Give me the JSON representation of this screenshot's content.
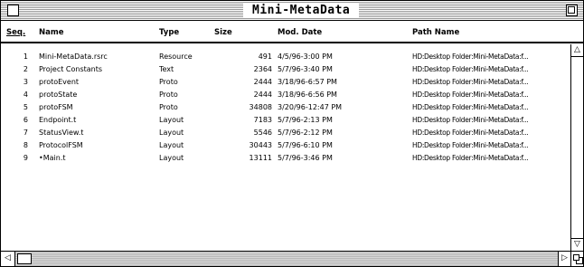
{
  "window": {
    "title": "Mini-MetaData"
  },
  "header": {
    "seq": "Seq.",
    "name": "Name",
    "type": "Type",
    "size": "Size",
    "date": "Mod. Date",
    "path": "Path Name"
  },
  "rows": [
    {
      "seq": "1",
      "name": "Mini-MetaData.rsrc",
      "type": "Resource",
      "size": "491",
      "date": "4/5/96-3:00 PM",
      "path": "HD:Desktop Folder:Mini-MetaData:f..."
    },
    {
      "seq": "2",
      "name": "Project Constants",
      "type": "Text",
      "size": "2364",
      "date": "5/7/96-3:40 PM",
      "path": "HD:Desktop Folder:Mini-MetaData:f..."
    },
    {
      "seq": "3",
      "name": "protoEvent",
      "type": "Proto",
      "size": "2444",
      "date": "3/18/96-6:57 PM",
      "path": "HD:Desktop Folder:Mini-MetaData:f..."
    },
    {
      "seq": "4",
      "name": "protoState",
      "type": "Proto",
      "size": "2444",
      "date": "3/18/96-6:56 PM",
      "path": "HD:Desktop Folder:Mini-MetaData:f..."
    },
    {
      "seq": "5",
      "name": "protoFSM",
      "type": "Proto",
      "size": "34808",
      "date": "3/20/96-12:47 PM",
      "path": "HD:Desktop Folder:Mini-MetaData:f..."
    },
    {
      "seq": "6",
      "name": "Endpoint.t",
      "type": "Layout",
      "size": "7183",
      "date": "5/7/96-2:13 PM",
      "path": "HD:Desktop Folder:Mini-MetaData:f..."
    },
    {
      "seq": "7",
      "name": "StatusView.t",
      "type": "Layout",
      "size": "5546",
      "date": "5/7/96-2:12 PM",
      "path": "HD:Desktop Folder:Mini-MetaData:f..."
    },
    {
      "seq": "8",
      "name": "ProtocolFSM",
      "type": "Layout",
      "size": "30443",
      "date": "5/7/96-6:10 PM",
      "path": "HD:Desktop Folder:Mini-MetaData:f..."
    },
    {
      "seq": "9",
      "name": "•Main.t",
      "type": "Layout",
      "size": "13111",
      "date": "5/7/96-3:46 PM",
      "path": "HD:Desktop Folder:Mini-MetaData:f..."
    }
  ],
  "icons": {
    "close": "close-box-icon",
    "zoom": "zoom-box-icon",
    "scroll_up": "△",
    "scroll_down": "▽",
    "scroll_left": "◁",
    "scroll_right": "▷",
    "grow": "grow-box-icon"
  }
}
